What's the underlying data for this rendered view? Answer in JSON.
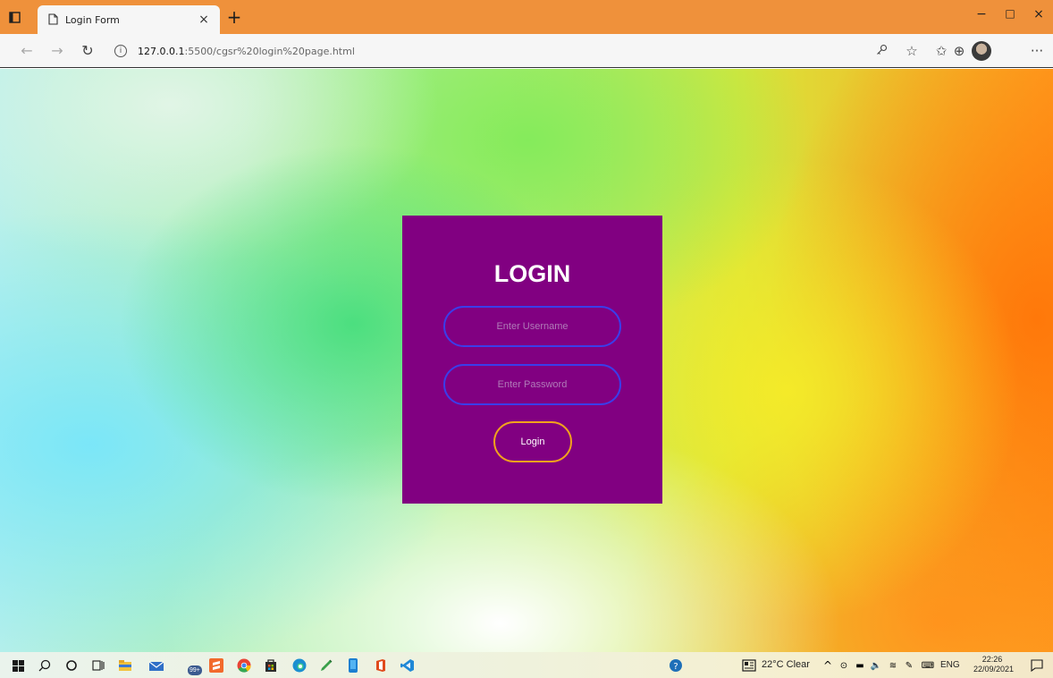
{
  "browser": {
    "tab_title": "Login Form",
    "tab_close": "×",
    "new_tab": "+",
    "url_host": "127.0.0.1",
    "url_path": ":5500/cgsr%20login%20page.html",
    "window_controls": {
      "minimize": "−",
      "maximize": "□",
      "close": "×"
    }
  },
  "page": {
    "title": "LOGIN",
    "username_placeholder": "Enter Username",
    "password_placeholder": "Enter Password",
    "login_button": "Login",
    "card_color": "#810081",
    "field_border_color": "#3b3dea",
    "button_border_color": "#f1a21d"
  },
  "taskbar": {
    "mail_badge": "99+",
    "weather": "22°C  Clear",
    "language": "ENG",
    "time": "22:26",
    "date": "22/09/2021"
  }
}
